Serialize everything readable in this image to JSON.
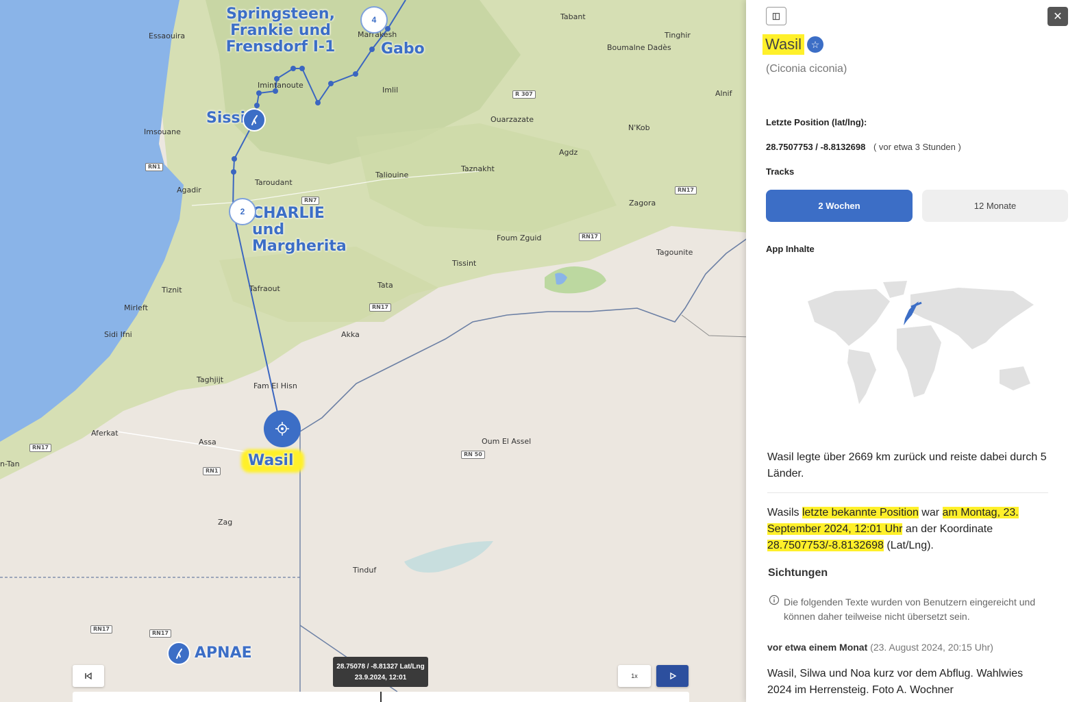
{
  "map": {
    "places": [
      {
        "name": "Essaouira"
      },
      {
        "name": "Tabant"
      },
      {
        "name": "Tinghir"
      },
      {
        "name": "Boumalne Dadès"
      },
      {
        "name": "Marrakesh"
      },
      {
        "name": "Imlil"
      },
      {
        "name": "Alnif"
      },
      {
        "name": "Imintanoute"
      },
      {
        "name": "Ouarzazate"
      },
      {
        "name": "N'Kob"
      },
      {
        "name": "Imsouane"
      },
      {
        "name": "Agdz"
      },
      {
        "name": "Taroudant"
      },
      {
        "name": "Taliouine"
      },
      {
        "name": "Taznakht"
      },
      {
        "name": "Agadir"
      },
      {
        "name": "Zagora"
      },
      {
        "name": "Foum Zguid"
      },
      {
        "name": "Tagounite"
      },
      {
        "name": "Tissint"
      },
      {
        "name": "Tiznit"
      },
      {
        "name": "Tafraout"
      },
      {
        "name": "Tata"
      },
      {
        "name": "Mirleft"
      },
      {
        "name": "Sidi Ifni"
      },
      {
        "name": "Akka"
      },
      {
        "name": "Taghjijt"
      },
      {
        "name": "Fam El Hisn"
      },
      {
        "name": "Aferkat"
      },
      {
        "name": "Assa"
      },
      {
        "name": "Oum El Assel"
      },
      {
        "name": "n-Tan"
      },
      {
        "name": "Zag"
      },
      {
        "name": "Tinduf"
      }
    ],
    "roads": [
      "R 307",
      "RN1",
      "RN7",
      "RN17",
      "RN17",
      "RN17",
      "RN17",
      "RN1",
      "RN17",
      "RN 50",
      "RN17",
      "RN17"
    ],
    "birds": {
      "springsteen": "Springsteen, Frankie und Frensdorf I-1",
      "gabo": "Gabo",
      "sissi": "Sissi",
      "charlie": "CHARLIE und Margherita",
      "wasil": "Wasil",
      "apnae": "APNAE"
    },
    "clusters": {
      "top": "4",
      "middle": "2"
    },
    "tooltip": {
      "coords": "28.75078 / -8.81327 Lat/Lng",
      "time": "23.9.2024, 12:01"
    },
    "controls": {
      "speed": "1x",
      "rewind_icon": "skip-back-icon",
      "play_icon": "play-icon"
    }
  },
  "panel": {
    "bird_name": "Wasil",
    "species": "(Ciconia ciconia)",
    "last_position_label": "Letzte Position (lat/lng):",
    "last_position_value": "28.7507753 / -8.8132698",
    "last_position_ago": "( vor etwa 3 Stunden )",
    "tracks_label": "Tracks",
    "tab_2weeks": "2 Wochen",
    "tab_12months": "12 Monate",
    "app_content_label": "App Inhalte",
    "summary": "Wasil legte über 2669 km zurück und reiste dabei durch 5 Länder.",
    "position_text": {
      "p1": "Wasils ",
      "h1": "letzte bekannte Position",
      "p2": " war ",
      "h2a": "am Montag, 23.",
      "h2b": "September 2024, 12:01 Uhr",
      "p3": " an der Koordinate",
      "h3": "28.7507753/-8.8132698",
      "p4": " (Lat/Lng)."
    },
    "sightings_label": "Sichtungen",
    "sightings_note": "Die folgenden Texte wurden von Benutzern eingereicht und können daher teilweise nicht übersetzt sein.",
    "sighting": {
      "when": "vor etwa einem Monat",
      "date": "(23. August 2024, 20:15 Uhr)",
      "text": "Wasil, Silwa und Noa kurz vor dem Abflug. Wahlwies 2024 im Herrensteig. Foto A. Wochner"
    },
    "colors": {
      "accent": "#3c6ec6",
      "highlight": "#fff02a"
    }
  }
}
